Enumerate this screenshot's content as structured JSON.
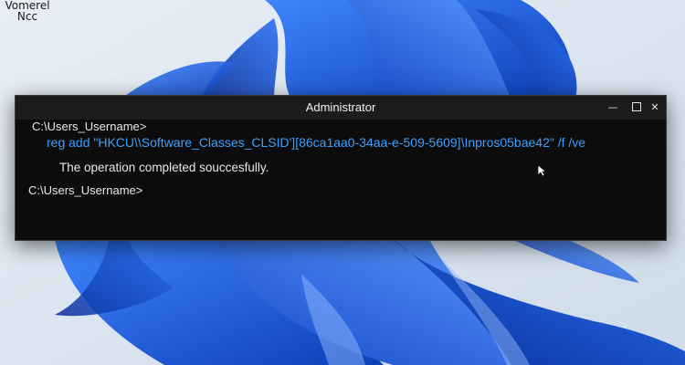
{
  "desktop": {
    "icon_label_line1": "Vomerel",
    "icon_label_line2": "Ncc"
  },
  "window": {
    "title": "Administrator",
    "controls": [
      "minimize",
      "maximize",
      "close"
    ],
    "minimize_glyph": "—",
    "close_glyph": "✕"
  },
  "console": {
    "prompt1": "C:\\Users_Username>",
    "command": "reg add \"HKCU\\\\Software_Classes_CLSID'][86ca1aa0-34aa-e-509-5609]\\Inpros05bae42\" /f /ve",
    "output": "The operation completed souccesfully.",
    "prompt2": "C:\\Users_Username>"
  },
  "colors": {
    "command_text": "#3ba0ff",
    "console_bg": "#0c0c0c",
    "wallpaper_blue": "#1a5fe0"
  }
}
